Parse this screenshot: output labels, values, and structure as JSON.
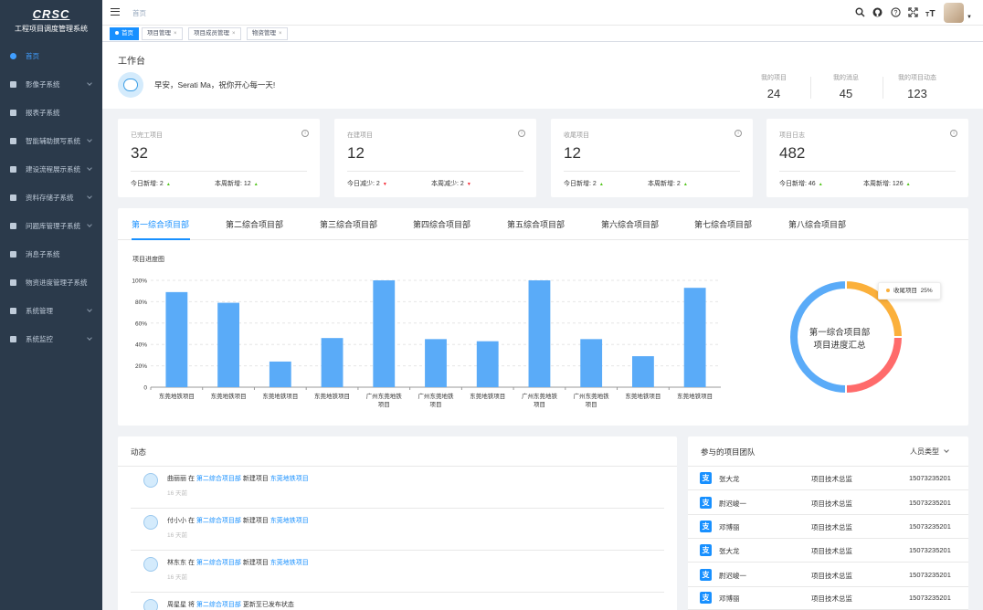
{
  "brand": {
    "logo": "CRSC",
    "system_name": "工程项目调度管理系统"
  },
  "sidebar": {
    "items": [
      {
        "label": "首页",
        "active": true,
        "expandable": false
      },
      {
        "label": "影像子系统",
        "expandable": true
      },
      {
        "label": "报表子系统",
        "expandable": false
      },
      {
        "label": "智能辅助撰写系统",
        "expandable": true
      },
      {
        "label": "建设流程展示系统",
        "expandable": true
      },
      {
        "label": "资料存储子系统",
        "expandable": true
      },
      {
        "label": "问题库管理子系统",
        "expandable": true
      },
      {
        "label": "消息子系统",
        "expandable": false
      },
      {
        "label": "物资进度管理子系统",
        "expandable": false
      },
      {
        "label": "系统管理",
        "expandable": true
      },
      {
        "label": "系统监控",
        "expandable": true
      }
    ]
  },
  "header": {
    "breadcrumb": "首页",
    "tools": [
      "search-icon",
      "github-icon",
      "question-icon",
      "fullscreen-icon",
      "font-size-icon"
    ]
  },
  "tags": [
    {
      "label": "首页",
      "active": true
    },
    {
      "label": "项目管理",
      "closable": true
    },
    {
      "label": "项目成员管理",
      "closable": true
    },
    {
      "label": "物资管理",
      "closable": true
    }
  ],
  "welcome": {
    "title": "工作台",
    "greeting": "早安，Serati Ma，祝你开心每一天!",
    "stats": [
      {
        "label": "我的项目",
        "value": "24"
      },
      {
        "label": "我的消息",
        "value": "45"
      },
      {
        "label": "我的项目动态",
        "value": "123"
      }
    ]
  },
  "cards": [
    {
      "title": "已完工项目",
      "value": "32",
      "left_label": "今日新增:",
      "left_value": "2",
      "left_trend": "up",
      "right_label": "本周新增:",
      "right_value": "12",
      "right_trend": "up"
    },
    {
      "title": "在建项目",
      "value": "12",
      "left_label": "今日减少:",
      "left_value": "2",
      "left_trend": "down",
      "right_label": "本周减少:",
      "right_value": "2",
      "right_trend": "down"
    },
    {
      "title": "收尾项目",
      "value": "12",
      "left_label": "今日新增:",
      "left_value": "2",
      "left_trend": "up",
      "right_label": "本周新增:",
      "right_value": "2",
      "right_trend": "up"
    },
    {
      "title": "项目日志",
      "value": "482",
      "left_label": "今日新增:",
      "left_value": "46",
      "left_trend": "up",
      "right_label": "本周新增:",
      "right_value": "126",
      "right_trend": "up"
    }
  ],
  "progress": {
    "tabs": [
      "第一综合项目部",
      "第二综合项目部",
      "第三综合项目部",
      "第四综合项目部",
      "第五综合项目部",
      "第六综合项目部",
      "第七综合项目部",
      "第八综合项目部"
    ],
    "chart_title": "项目进度图",
    "donut_center_line1": "第一综合项目部",
    "donut_center_line2": "项目进度汇总",
    "tooltip_label": "收尾项目",
    "tooltip_value": "25%"
  },
  "chart_data": [
    {
      "type": "bar",
      "title": "项目进度图",
      "categories": [
        [
          "东莞地铁项目"
        ],
        [
          "东莞地铁项目"
        ],
        [
          "东莞地铁项目"
        ],
        [
          "东莞地铁项目"
        ],
        [
          "广州东莞地铁",
          "项目"
        ],
        [
          "广州东莞地铁",
          "项目"
        ],
        [
          "东莞地铁项目"
        ],
        [
          "广州东莞地铁",
          "项目"
        ],
        [
          "广州东莞地铁",
          "项目"
        ],
        [
          "东莞地铁项目"
        ],
        [
          "东莞地铁项目"
        ]
      ],
      "values": [
        89,
        79,
        24,
        46,
        100,
        45,
        43,
        100,
        45,
        29,
        93
      ],
      "yticks": [
        "0",
        "20%",
        "40%",
        "60%",
        "80%",
        "100%"
      ],
      "ylim": [
        0,
        100
      ],
      "color": "#5aabf8"
    },
    {
      "type": "pie",
      "title": "",
      "slices": [
        {
          "name": "收尾项目",
          "value": 25,
          "color": "#fbb03b"
        },
        {
          "name": "",
          "value": 25,
          "color": "#ff6b6b"
        },
        {
          "name": "",
          "value": 50,
          "color": "#5aabf8"
        }
      ]
    }
  ],
  "activity": {
    "title": "动态",
    "items": [
      {
        "user": "曲丽丽",
        "verb": "在",
        "group": "第二综合项目部",
        "action": "新建项目",
        "project": "东莞地铁项目",
        "time": "16 天前"
      },
      {
        "user": "付小小",
        "verb": "在",
        "group": "第二综合项目部",
        "action": "新建项目",
        "project": "东莞地铁项目",
        "time": "16 天前"
      },
      {
        "user": "林东东",
        "verb": "在",
        "group": "第二综合项目部",
        "action": "新建项目",
        "project": "东莞地铁项目",
        "time": "16 天前"
      },
      {
        "user": "周星星",
        "verb": "将",
        "group": "第二综合项目部",
        "action": "更新至已发布状态",
        "project": "",
        "time": ""
      }
    ]
  },
  "team": {
    "title": "参与的项目团队",
    "filter": "人员类型",
    "members": [
      {
        "name": "张大龙",
        "role": "项目技术总监",
        "phone": "15073235201"
      },
      {
        "name": "尉迟峻一",
        "role": "项目技术总监",
        "phone": "15073235201"
      },
      {
        "name": "邓博丽",
        "role": "项目技术总监",
        "phone": "15073235201"
      },
      {
        "name": "张大龙",
        "role": "项目技术总监",
        "phone": "15073235201"
      },
      {
        "name": "尉迟峻一",
        "role": "项目技术总监",
        "phone": "15073235201"
      },
      {
        "name": "邓博丽",
        "role": "项目技术总监",
        "phone": "15073235201"
      }
    ]
  }
}
